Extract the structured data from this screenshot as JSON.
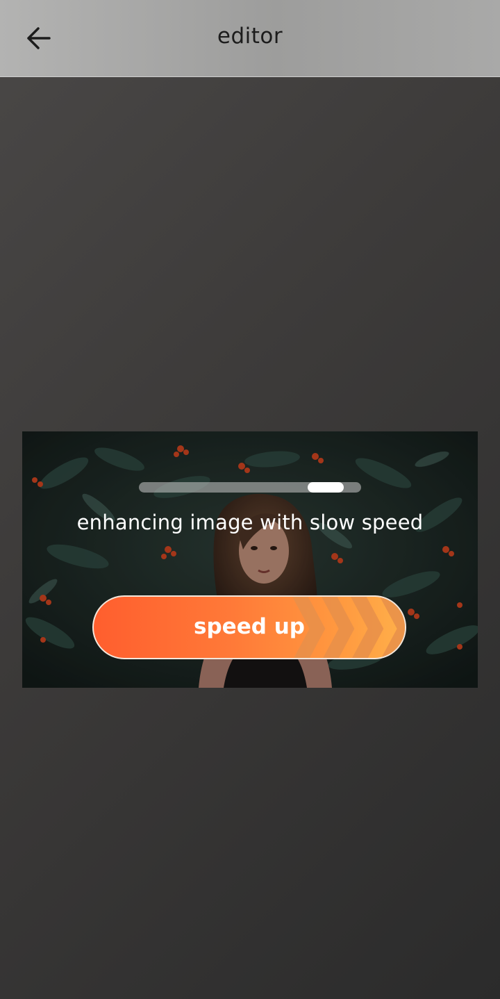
{
  "header": {
    "title": "editor",
    "back_icon": "arrow-left-icon"
  },
  "processing": {
    "status_text": "enhancing image with slow speed",
    "progress_percent": 84,
    "speed_up_label": "speed up",
    "button_icon": "chevrons-right-icon"
  },
  "colors": {
    "accent_start": "#ff5e2e",
    "accent_end": "#ffb04a",
    "header_bg": "#a9a9a8",
    "page_bg": "#3d3b3a"
  }
}
